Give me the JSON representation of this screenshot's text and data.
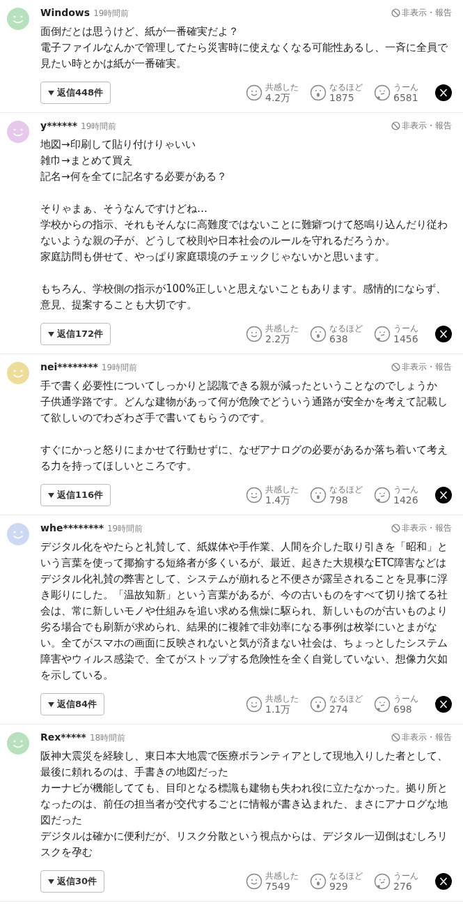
{
  "comments": [
    {
      "name": "Windows",
      "time": "19時間前",
      "color": "#b7e0bd",
      "hide": "非表示・報告",
      "paragraphs": [
        [
          "面倒だとは思うけど、紙が一番確実だよ？",
          "電子ファイルなんかで管理してたら災害時に使えなくなる可能性あるし、一斉に全員で見たい時とかは紙が一番確実。"
        ]
      ],
      "reply": "返信448件",
      "reactions": [
        {
          "kind": "empathy",
          "label": "共感した",
          "count": "4.2万"
        },
        {
          "kind": "insight",
          "label": "なるほど",
          "count": "1875"
        },
        {
          "kind": "doubt",
          "label": "うーん",
          "count": "6581"
        }
      ]
    },
    {
      "name": "y******",
      "time": "19時間前",
      "color": "#e6c8ec",
      "hide": "非表示・報告",
      "paragraphs": [
        [
          "地図→印刷して貼り付けりゃいい",
          "雑巾→まとめて買え",
          "記名→何を全てに記名する必要がある？"
        ],
        [
          "そりゃまぁ、そうなんですけどね…",
          "学校からの指示、それもそんなに高難度ではないことに難癖つけて怒鳴り込んだり従わないような親の子が、どうして校則や日本社会のルールを守れるだろうか。",
          "家庭訪問も併せて、やっぱり家庭環境のチェックじゃないかと思います。"
        ],
        [
          "もちろん、学校側の指示が100%正しいと思えないこともあります。感情的にならず、意見、提案することも大切です。"
        ]
      ],
      "reply": "返信172件",
      "reactions": [
        {
          "kind": "empathy",
          "label": "共感した",
          "count": "2.2万"
        },
        {
          "kind": "insight",
          "label": "なるほど",
          "count": "638"
        },
        {
          "kind": "doubt",
          "label": "うーん",
          "count": "1456"
        }
      ]
    },
    {
      "name": "nei********",
      "time": "19時間前",
      "color": "#eddc9a",
      "hide": "非表示・報告",
      "paragraphs": [
        [
          "手で書く必要性についてしっかりと認識できる親が減ったということなのでしょうか",
          "子供通学路です。どんな建物があって何が危険でどういう通路が安全かを考えて記載して欲しいのでわざわざ手で書いてもらうのです。"
        ],
        [
          "すぐにかっと怒りにまかせて行動せずに、なぜアナログの必要があるか落ち着いて考える力を持ってほしいところです。"
        ]
      ],
      "reply": "返信116件",
      "reactions": [
        {
          "kind": "empathy",
          "label": "共感した",
          "count": "1.4万"
        },
        {
          "kind": "insight",
          "label": "なるほど",
          "count": "798"
        },
        {
          "kind": "doubt",
          "label": "うーん",
          "count": "1426"
        }
      ]
    },
    {
      "name": "whe********",
      "time": "19時間前",
      "color": "#cdd9f3",
      "hide": "非表示・報告",
      "paragraphs": [
        [
          "デジタル化をやたらと礼賛して、紙媒体や手作業、人間を介した取り引きを「昭和」という言葉を使って揶揄する短絡者が多くいるが、最近、起きた大規模なETC障害などはデジタル化礼賛の弊害として、システムが崩れると不便さが露呈されることを見事に浮き彫りにした。「温故知新」という言葉があるが、今の古いものをすべて切り捨てる社会は、常に新しいモノや仕組みを追い求める焦燥に駆られ、新しいものが古いものより劣る場合でも刷新が求められ、結果的に複雑で非効率になる事例は枚挙にいとまがない。全てがスマホの画面に反映されないと気が済まない社会は、ちょっとしたシステム障害やウィルス感染で、全てがストップする危険性を全く自覚していない、想像力欠如を示している。"
        ]
      ],
      "reply": "返信84件",
      "reactions": [
        {
          "kind": "empathy",
          "label": "共感した",
          "count": "1.1万"
        },
        {
          "kind": "insight",
          "label": "なるほど",
          "count": "274"
        },
        {
          "kind": "doubt",
          "label": "うーん",
          "count": "698"
        }
      ]
    },
    {
      "name": "Rex*****",
      "time": "18時間前",
      "color": "#b7e0bd",
      "hide": "非表示・報告",
      "paragraphs": [
        [
          "阪神大震災を経験し、東日本大地震で医療ボランティアとして現地入りした者として、",
          "最後に頼れるのは、手書きの地図だった",
          "カーナビが機能してても、目印となる標識も建物も失われ役に立たなかった。拠り所となったのは、前任の担当者が交代するごとに情報が書き込まれた、まさにアナログな地図だった",
          "デジタルは確かに便利だが、リスク分散という視点からは、デジタル一辺倒はむしろリスクを孕む"
        ]
      ],
      "reply": "返信30件",
      "reactions": [
        {
          "kind": "empathy",
          "label": "共感した",
          "count": "7549"
        },
        {
          "kind": "insight",
          "label": "なるほど",
          "count": "929"
        },
        {
          "kind": "doubt",
          "label": "うーん",
          "count": "276"
        }
      ]
    }
  ]
}
